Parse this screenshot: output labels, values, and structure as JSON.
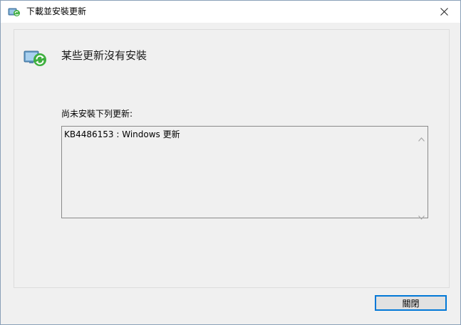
{
  "window": {
    "title": "下載並安裝更新"
  },
  "content": {
    "heading": "某些更新沒有安裝",
    "list_label": "尚未安裝下列更新:",
    "items": [
      "KB4486153 : Windows 更新"
    ]
  },
  "footer": {
    "close_label": "關閉"
  },
  "icons": {
    "title": "windows-update-icon",
    "heading": "update-sync-icon",
    "close": "close-icon"
  },
  "colors": {
    "accent": "#0078d7",
    "window_bg": "#f0f0f0",
    "titlebar_bg": "#ffffff"
  }
}
